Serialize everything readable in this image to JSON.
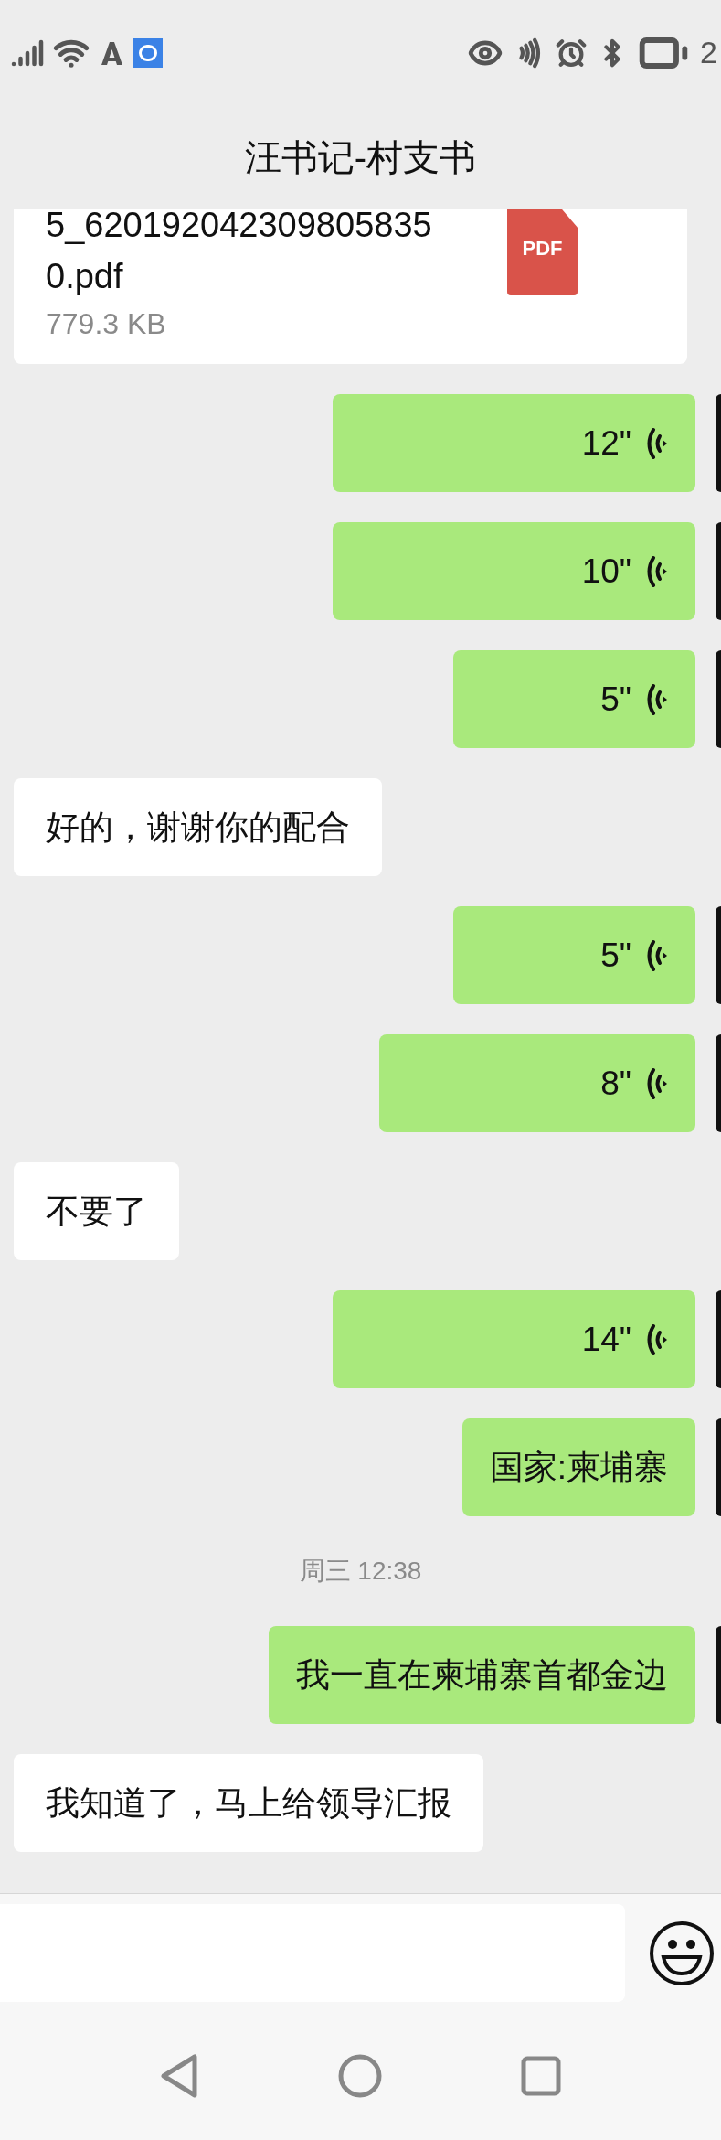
{
  "status_bar": {
    "battery_text": "2"
  },
  "header": {
    "title": "汪书记-村支书"
  },
  "messages": [
    {
      "kind": "file",
      "outgoing": false,
      "name": "5_620192042309805835",
      "name_cont": "0.pdf",
      "size": "779.3 KB",
      "badge": "PDF"
    },
    {
      "kind": "voice",
      "outgoing": true,
      "duration": "12\""
    },
    {
      "kind": "voice",
      "outgoing": true,
      "duration": "10\""
    },
    {
      "kind": "voice",
      "outgoing": true,
      "duration": "5\""
    },
    {
      "kind": "text",
      "outgoing": false,
      "text": "好的，谢谢你的配合"
    },
    {
      "kind": "voice",
      "outgoing": true,
      "duration": "5\""
    },
    {
      "kind": "voice",
      "outgoing": true,
      "duration": "8\""
    },
    {
      "kind": "text",
      "outgoing": false,
      "text": "不要了"
    },
    {
      "kind": "voice",
      "outgoing": true,
      "duration": "14\""
    },
    {
      "kind": "text",
      "outgoing": true,
      "text": "国家:柬埔寨"
    },
    {
      "kind": "time",
      "text": "周三 12:38"
    },
    {
      "kind": "text",
      "outgoing": true,
      "text": "我一直在柬埔寨首都金边"
    },
    {
      "kind": "text",
      "outgoing": false,
      "text": "我知道了，马上给领导汇报"
    }
  ]
}
